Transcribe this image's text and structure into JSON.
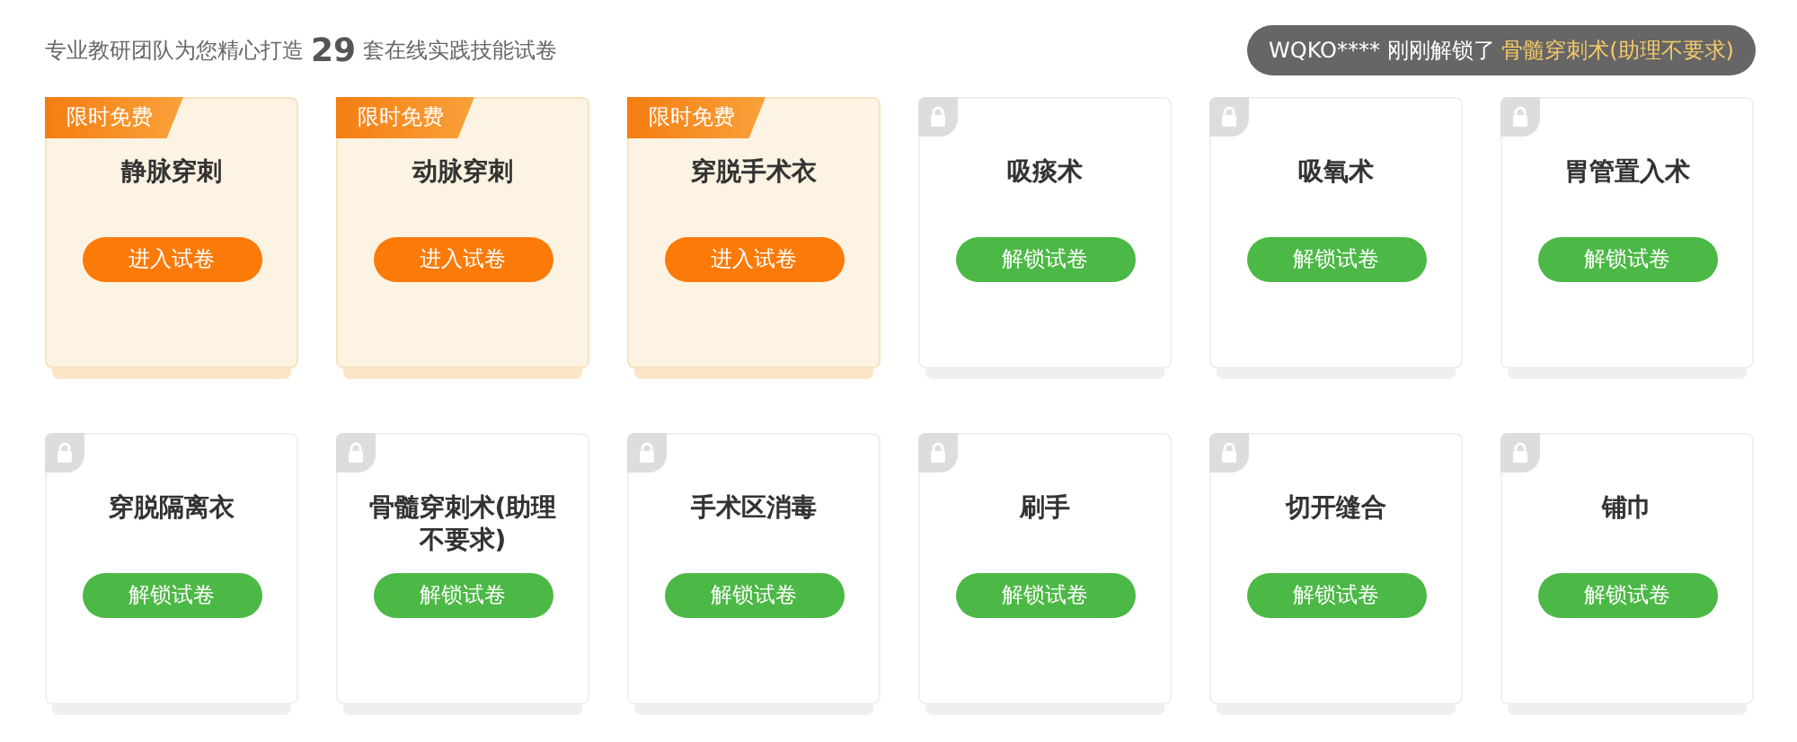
{
  "header": {
    "prefix": "专业教研团队为您精心打造",
    "count": "29",
    "suffix": "套在线实践技能试卷"
  },
  "notice": {
    "user": "WQKO****",
    "action": "刚刚解锁了",
    "item": "骨髓穿刺术(助理不要求)"
  },
  "papers": [
    {
      "kind": "free",
      "tag": "限时免费",
      "title": "静脉穿刺",
      "button": "进入试卷"
    },
    {
      "kind": "free",
      "tag": "限时免费",
      "title": "动脉穿刺",
      "button": "进入试卷"
    },
    {
      "kind": "free",
      "tag": "限时免费",
      "title": "穿脱手术衣",
      "button": "进入试卷"
    },
    {
      "kind": "locked",
      "title": "吸痰术",
      "button": "解锁试卷"
    },
    {
      "kind": "locked",
      "title": "吸氧术",
      "button": "解锁试卷"
    },
    {
      "kind": "locked",
      "title": "胃管置入术",
      "button": "解锁试卷"
    },
    {
      "kind": "locked",
      "title": "穿脱隔离衣",
      "button": "解锁试卷"
    },
    {
      "kind": "locked",
      "title": "骨髓穿刺术(助理不要求)",
      "button": "解锁试卷"
    },
    {
      "kind": "locked",
      "title": "手术区消毒",
      "button": "解锁试卷"
    },
    {
      "kind": "locked",
      "title": "刷手",
      "button": "解锁试卷"
    },
    {
      "kind": "locked",
      "title": "切开缝合",
      "button": "解锁试卷"
    },
    {
      "kind": "locked",
      "title": "铺巾",
      "button": "解锁试卷"
    }
  ]
}
